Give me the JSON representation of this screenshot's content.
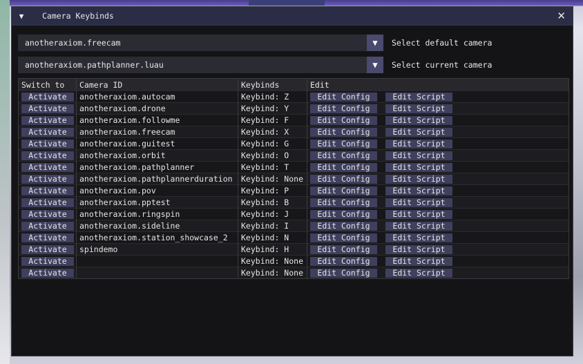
{
  "window": {
    "title": "Camera Keybinds",
    "close_glyph": "✕",
    "collapse_glyph": "▼"
  },
  "default_camera": {
    "value": "anotheraxiom.freecam",
    "label": "Select default camera",
    "arrow": "▼"
  },
  "current_camera": {
    "value": "anotheraxiom.pathplanner.luau",
    "label": "Select current camera",
    "arrow": "▼"
  },
  "table": {
    "headers": [
      "Switch to",
      "Camera ID",
      "Keybinds",
      "Edit"
    ],
    "activate_label": "Activate",
    "edit_config_label": "Edit Config",
    "edit_script_label": "Edit Script",
    "rows": [
      {
        "id": "anotheraxiom.autocam",
        "keybind": "Keybind: Z"
      },
      {
        "id": "anotheraxiom.drone",
        "keybind": "Keybind: Y"
      },
      {
        "id": "anotheraxiom.followme",
        "keybind": "Keybind: F"
      },
      {
        "id": "anotheraxiom.freecam",
        "keybind": "Keybind: X"
      },
      {
        "id": "anotheraxiom.guitest",
        "keybind": "Keybind: G"
      },
      {
        "id": "anotheraxiom.orbit",
        "keybind": "Keybind: O"
      },
      {
        "id": "anotheraxiom.pathplanner",
        "keybind": "Keybind: T"
      },
      {
        "id": "anotheraxiom.pathplannerduration",
        "keybind": "Keybind: None"
      },
      {
        "id": "anotheraxiom.pov",
        "keybind": "Keybind: P"
      },
      {
        "id": "anotheraxiom.pptest",
        "keybind": "Keybind: B"
      },
      {
        "id": "anotheraxiom.ringspin",
        "keybind": "Keybind: J"
      },
      {
        "id": "anotheraxiom.sideline",
        "keybind": "Keybind: I"
      },
      {
        "id": "anotheraxiom.station_showcase_2",
        "keybind": "Keybind: N"
      },
      {
        "id": "spindemo",
        "keybind": "Keybind: H"
      },
      {
        "id": "",
        "keybind": "Keybind: None"
      },
      {
        "id": "",
        "keybind": "Keybind: None"
      }
    ]
  },
  "colors": {
    "title_bar": "#2a2d45",
    "button": "#3f3f5e",
    "combo_arrow": "#4a4a6e",
    "window_bg": "#141417"
  }
}
